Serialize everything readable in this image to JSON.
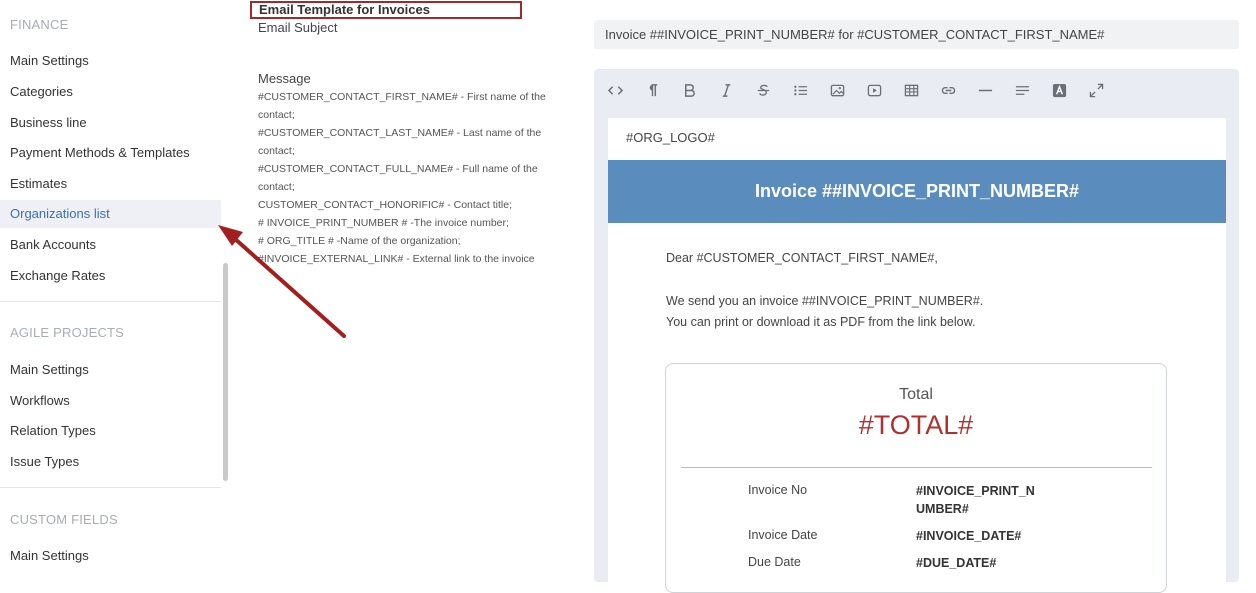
{
  "sidebar": {
    "finance": {
      "title": "FINANCE",
      "items": [
        "Main Settings",
        "Categories",
        "Business line",
        "Payment Methods & Templates",
        "Estimates",
        "Organizations list",
        "Bank Accounts",
        "Exchange Rates"
      ],
      "active": "Organizations list"
    },
    "agile": {
      "title": "AGILE PROJECTS",
      "items": [
        "Main Settings",
        "Workflows",
        "Relation Types",
        "Issue Types"
      ]
    },
    "custom_fields": {
      "title": "CUSTOM FIELDS",
      "items": [
        "Main Settings"
      ]
    }
  },
  "template": {
    "title": "Email Template for Invoices",
    "subject_label": "Email Subject",
    "subject_value": "Invoice ##INVOICE_PRINT_NUMBER# for #CUSTOMER_CONTACT_FIRST_NAME#",
    "message_label": "Message",
    "message_help": [
      "#CUSTOMER_CONTACT_FIRST_NAME# - First name of the contact;",
      "#CUSTOMER_CONTACT_LAST_NAME# - Last name of the contact;",
      "#CUSTOMER_CONTACT_FULL_NAME# - Full name of the contact;",
      "CUSTOMER_CONTACT_HONORIFIC# - Contact title;",
      "# INVOICE_PRINT_NUMBER # -The invoice number;",
      "# ORG_TITLE # -Name of the organization;",
      "#INVOICE_EXTERNAL_LINK# - External link to the invoice"
    ]
  },
  "toolbar": {
    "buttons": [
      "code-icon",
      "paragraph-icon",
      "bold-icon",
      "italic-icon",
      "strikethrough-icon",
      "bullet-list-icon",
      "image-icon",
      "video-icon",
      "table-icon",
      "link-icon",
      "horizontal-rule-icon",
      "align-icon",
      "font-color-icon",
      "fullscreen-icon"
    ]
  },
  "email": {
    "org_logo": "#ORG_LOGO#",
    "banner": "Invoice ##INVOICE_PRINT_NUMBER#",
    "greeting": "Dear #CUSTOMER_CONTACT_FIRST_NAME#,",
    "line1": "We send you an invoice ##INVOICE_PRINT_NUMBER#.",
    "line2": "You can print or download it as PDF from the link below.",
    "total_label": "Total",
    "total_value": "#TOTAL#",
    "rows": [
      {
        "label": "Invoice No",
        "value": "#INVOICE_PRINT_NUMBER#"
      },
      {
        "label": "Invoice Date",
        "value": "#INVOICE_DATE#"
      },
      {
        "label": "Due Date",
        "value": "#DUE_DATE#"
      }
    ]
  },
  "colors": {
    "active_link": "#3d6fb6",
    "banner": "#5b8cbe",
    "total": "#b0302f",
    "highlight_border": "#a02a2a",
    "arrow": "#a31f1f"
  }
}
